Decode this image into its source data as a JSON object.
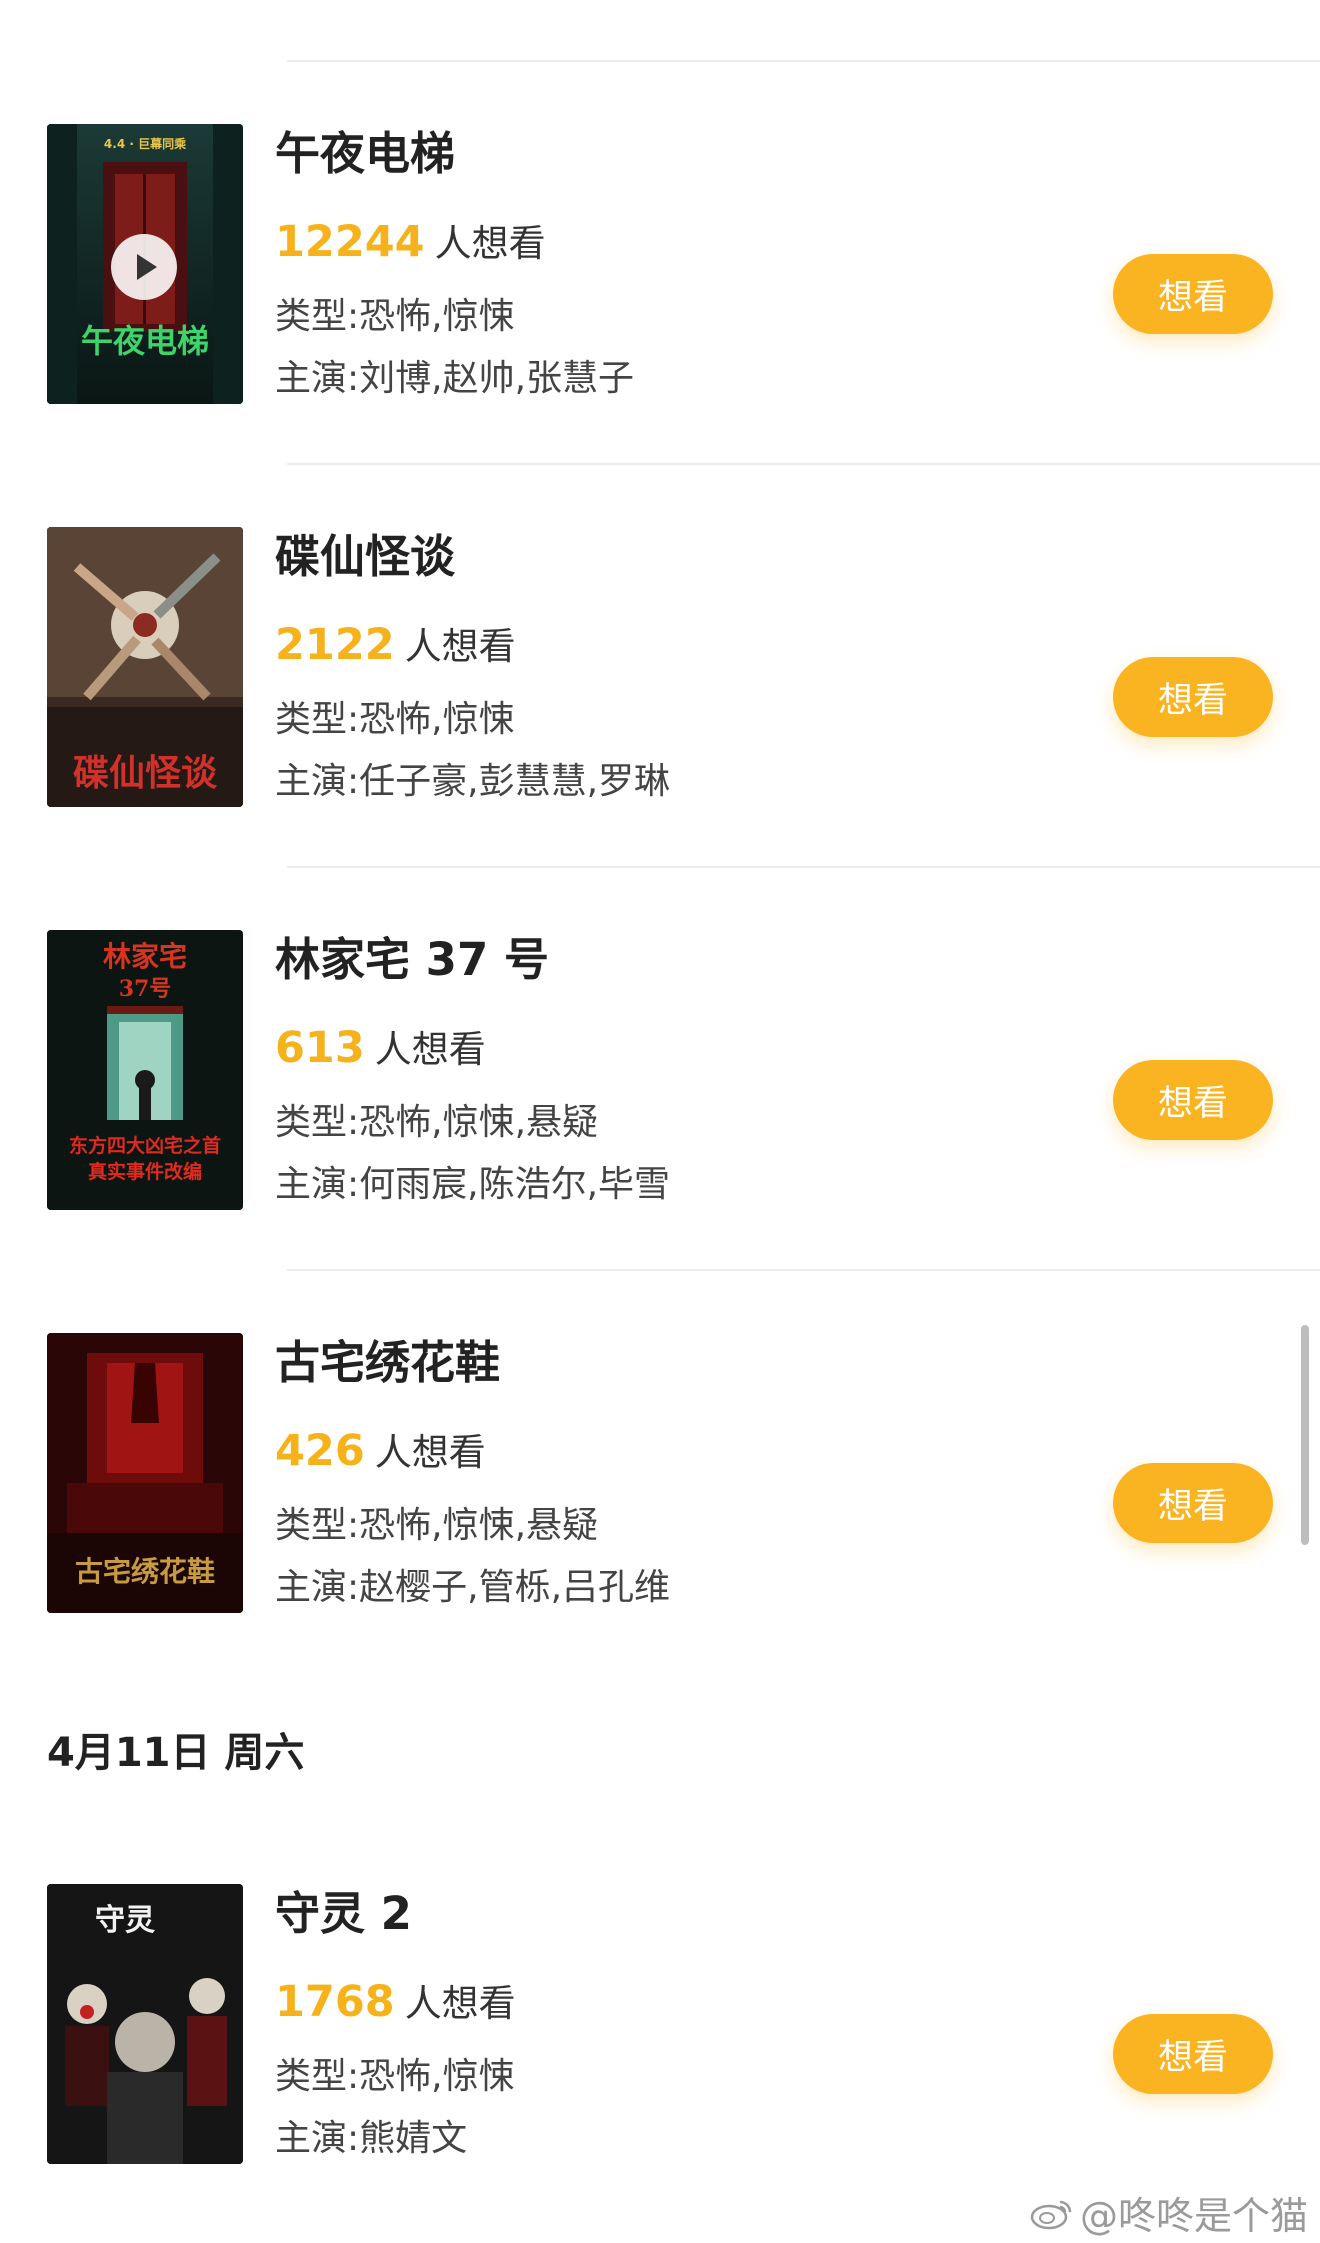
{
  "movies_a": [
    {
      "title": "午夜电梯",
      "count": "12244",
      "want_text": "人想看",
      "genre": "类型:恐怖,惊悚",
      "cast": "主演:刘博,赵帅,张慧子",
      "poster_text": "午夜电梯",
      "poster_date": "4.4 · 巨幕同乘",
      "button": "想看"
    },
    {
      "title": "碟仙怪谈",
      "count": "2122",
      "want_text": "人想看",
      "genre": "类型:恐怖,惊悚",
      "cast": "主演:任子豪,彭慧慧,罗琳",
      "poster_text": "碟仙怪谈",
      "button": "想看"
    },
    {
      "title": "林家宅 37 号",
      "count": "613",
      "want_text": "人想看",
      "genre": "类型:恐怖,惊悚,悬疑",
      "cast": "主演:何雨宸,陈浩尔,毕雪",
      "poster_text": "林家宅",
      "poster_text2": "37号",
      "poster_tag1": "东方四大凶宅之首",
      "poster_tag2": "真实事件改编",
      "button": "想看"
    },
    {
      "title": "古宅绣花鞋",
      "count": "426",
      "want_text": "人想看",
      "genre": "类型:恐怖,惊悚,悬疑",
      "cast": "主演:赵樱子,管栎,吕孔维",
      "poster_text": "古宅绣花鞋",
      "button": "想看"
    }
  ],
  "date_header": "4月11日 周六",
  "movies_b": [
    {
      "title": "守灵 2",
      "count": "1768",
      "want_text": "人想看",
      "genre": "类型:恐怖,惊悚",
      "cast": "主演:熊婧文",
      "poster_text": "守灵",
      "button": "想看"
    }
  ],
  "watermark": "@咚咚是个猫",
  "colors": {
    "accent": "#f6b21a",
    "button": "#fbb421",
    "text": "#222222",
    "divider": "#ededed"
  }
}
